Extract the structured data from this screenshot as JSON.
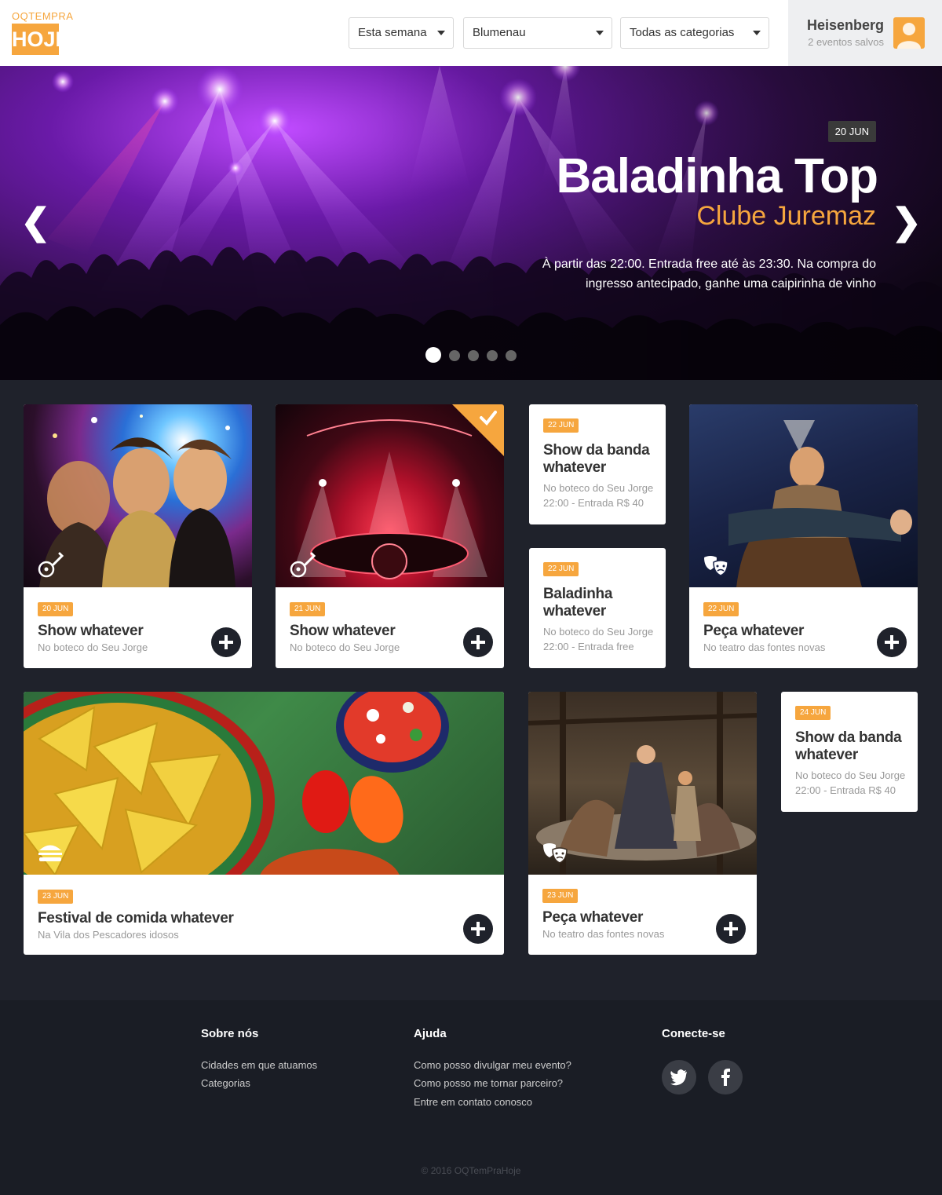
{
  "logo": {
    "top": "OQTEMPRA",
    "bottom": "HOJE"
  },
  "filters": {
    "period": "Esta semana",
    "city": "Blumenau",
    "category": "Todas as categorias"
  },
  "user": {
    "name": "Heisenberg",
    "saved": "2 eventos salvos"
  },
  "hero": {
    "date": "20 JUN",
    "title": "Baladinha Top",
    "venue": "Clube Juremaz",
    "description": "À partir das 22:00. Entrada free até às 23:30. Na compra do ingresso antecipado, ganhe uma caipirinha de vinho",
    "prev": "❮",
    "next": "❯",
    "slides": 5,
    "active_slide": 1
  },
  "cards": [
    {
      "date": "20 JUN",
      "title": "Show whatever",
      "location": "No boteco do Seu Jorge",
      "icon": "guitar-icon"
    },
    {
      "date": "21 JUN",
      "title": "Show whatever",
      "location": "No boteco do Seu Jorge",
      "icon": "guitar-icon",
      "saved": true
    },
    {
      "date": "22 JUN",
      "title": "Show da banda whatever",
      "line1": "No boteco do Seu Jorge",
      "line2": "22:00 - Entrada R$ 40"
    },
    {
      "date": "22 JUN",
      "title": "Baladinha whatever",
      "line1": "No boteco do Seu Jorge",
      "line2": "22:00 - Entrada free"
    },
    {
      "date": "22 JUN",
      "title": "Peça whatever",
      "location": "No teatro das fontes novas",
      "icon": "theater-masks-icon"
    },
    {
      "date": "23 JUN",
      "title": "Festival de comida whatever",
      "location": "Na Vila dos Pescadores idosos",
      "icon": "burger-icon"
    },
    {
      "date": "23 JUN",
      "title": "Peça whatever",
      "location": "No teatro das fontes novas",
      "icon": "theater-masks-icon"
    },
    {
      "date": "24 JUN",
      "title": "Show da banda whatever",
      "line1": "No boteco do Seu Jorge",
      "line2": "22:00 - Entrada R$ 40"
    }
  ],
  "footer": {
    "about": {
      "title": "Sobre nós",
      "links": [
        "Cidades em que atuamos",
        "Categorias"
      ]
    },
    "help": {
      "title": "Ajuda",
      "links": [
        "Como posso divulgar meu evento?",
        "Como posso me tornar parceiro?",
        "Entre em contato conosco"
      ]
    },
    "connect": {
      "title": "Conecte-se"
    },
    "copyright": "© 2016 OQTemPraHoje"
  },
  "colors": {
    "accent": "#f6a63e",
    "dark": "#1f222b",
    "footer": "#1a1d25"
  }
}
